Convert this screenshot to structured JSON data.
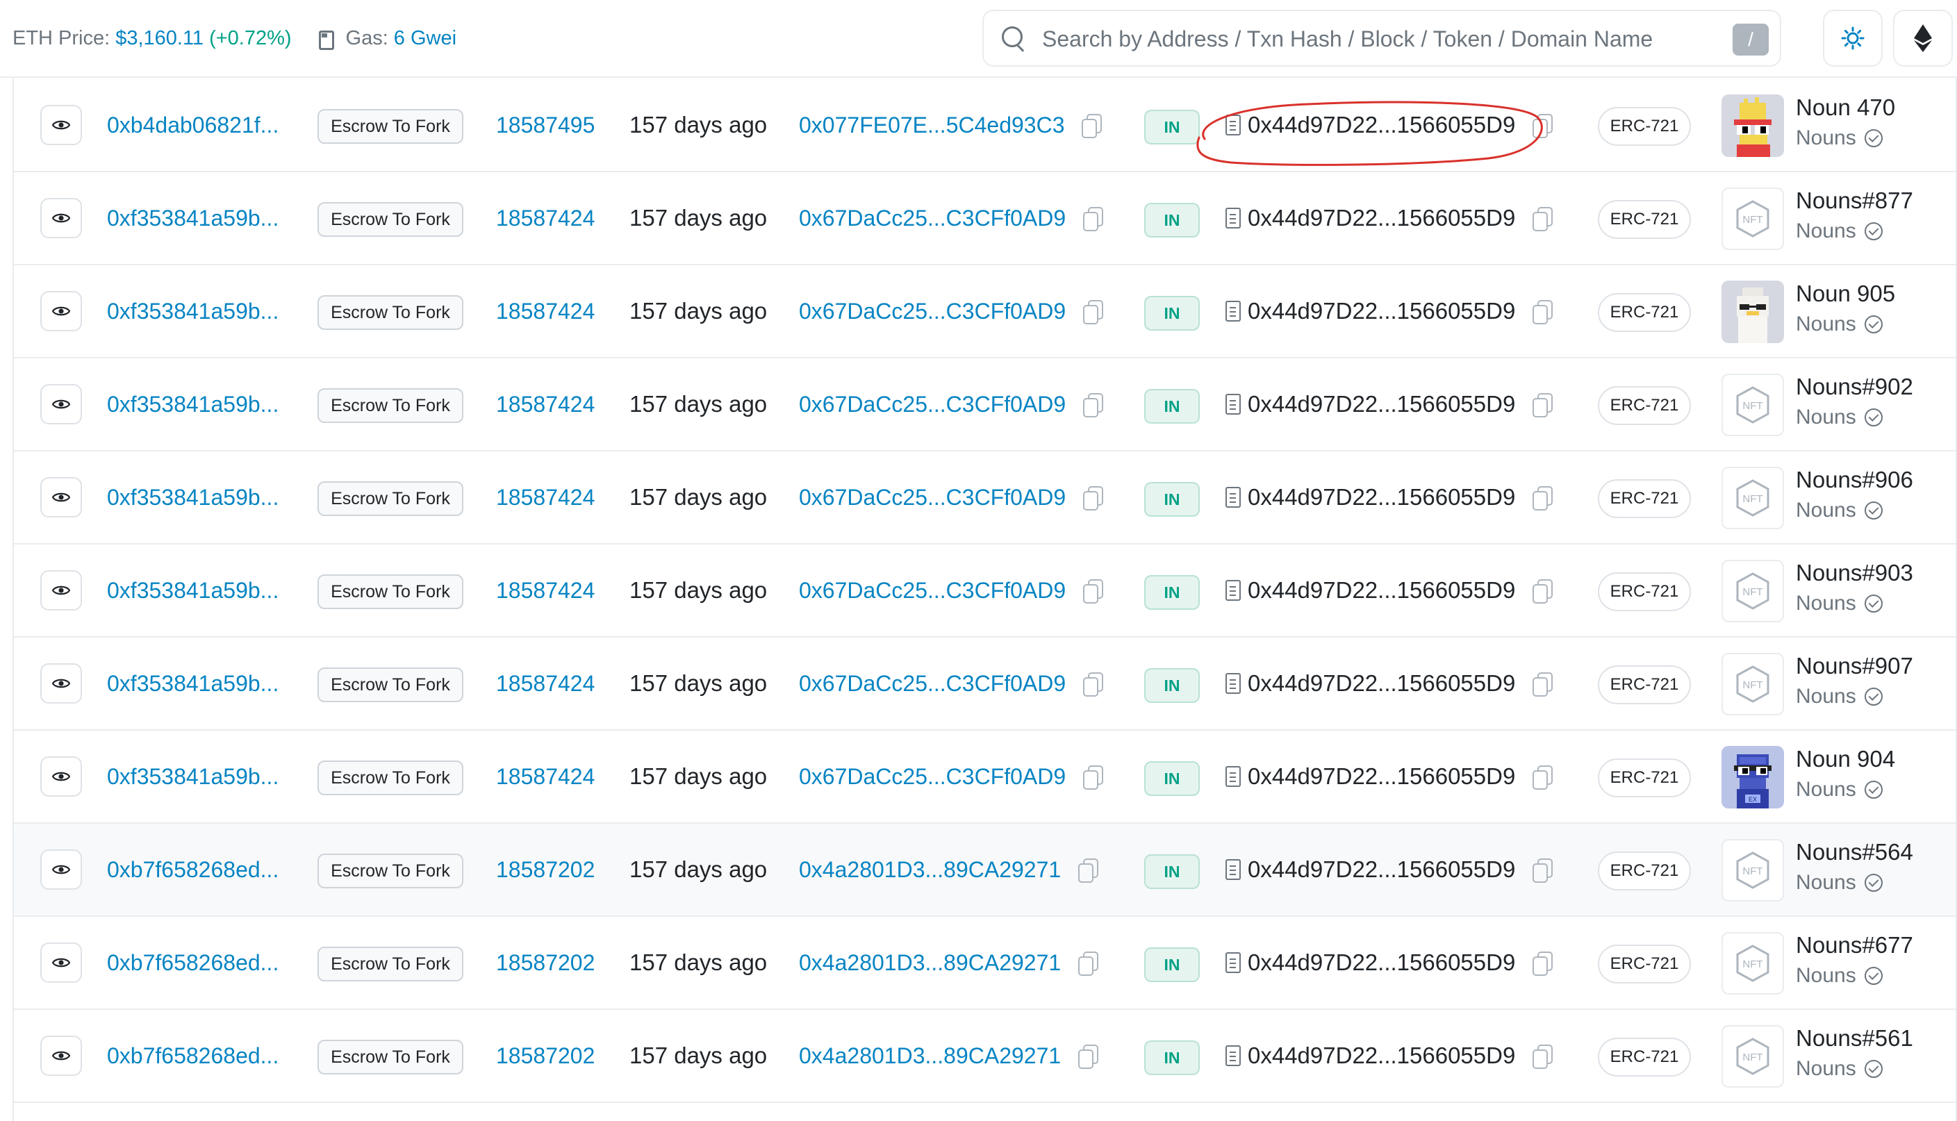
{
  "header": {
    "eth_price_label": "ETH Price:",
    "eth_price_value": "$3,160.11",
    "eth_price_change": "(+0.72%)",
    "gas_label": "Gas:",
    "gas_value": "6 Gwei",
    "search_placeholder": "Search by Address / Txn Hash / Block / Token / Domain Name",
    "search_shortcut": "/",
    "icons": [
      "search-icon",
      "sun-icon",
      "ethereum-icon"
    ]
  },
  "colors": {
    "link": "#0784c3",
    "in_badge": "#00a186",
    "annotation": "#d9312b",
    "muted": "#6c757d"
  },
  "rows": [
    {
      "tx_hash": "0xb4dab06821f...",
      "method": "Escrow To Fork",
      "block": "18587495",
      "age": "157 days ago",
      "from": "0x077FE07E...5C4ed93C3",
      "direction": "IN",
      "to": "0x44d97D22...1566055D9",
      "token_type": "ERC-721",
      "item_name": "Noun 470",
      "collection": "Nouns",
      "thumb": "noun-470"
    },
    {
      "tx_hash": "0xf353841a59b...",
      "method": "Escrow To Fork",
      "block": "18587424",
      "age": "157 days ago",
      "from": "0x67DaCc25...C3CFf0AD9",
      "direction": "IN",
      "to": "0x44d97D22...1566055D9",
      "token_type": "ERC-721",
      "item_name": "Nouns#877",
      "collection": "Nouns",
      "thumb": "nft-placeholder"
    },
    {
      "tx_hash": "0xf353841a59b...",
      "method": "Escrow To Fork",
      "block": "18587424",
      "age": "157 days ago",
      "from": "0x67DaCc25...C3CFf0AD9",
      "direction": "IN",
      "to": "0x44d97D22...1566055D9",
      "token_type": "ERC-721",
      "item_name": "Noun 905",
      "collection": "Nouns",
      "thumb": "noun-905"
    },
    {
      "tx_hash": "0xf353841a59b...",
      "method": "Escrow To Fork",
      "block": "18587424",
      "age": "157 days ago",
      "from": "0x67DaCc25...C3CFf0AD9",
      "direction": "IN",
      "to": "0x44d97D22...1566055D9",
      "token_type": "ERC-721",
      "item_name": "Nouns#902",
      "collection": "Nouns",
      "thumb": "nft-placeholder"
    },
    {
      "tx_hash": "0xf353841a59b...",
      "method": "Escrow To Fork",
      "block": "18587424",
      "age": "157 days ago",
      "from": "0x67DaCc25...C3CFf0AD9",
      "direction": "IN",
      "to": "0x44d97D22...1566055D9",
      "token_type": "ERC-721",
      "item_name": "Nouns#906",
      "collection": "Nouns",
      "thumb": "nft-placeholder"
    },
    {
      "tx_hash": "0xf353841a59b...",
      "method": "Escrow To Fork",
      "block": "18587424",
      "age": "157 days ago",
      "from": "0x67DaCc25...C3CFf0AD9",
      "direction": "IN",
      "to": "0x44d97D22...1566055D9",
      "token_type": "ERC-721",
      "item_name": "Nouns#903",
      "collection": "Nouns",
      "thumb": "nft-placeholder"
    },
    {
      "tx_hash": "0xf353841a59b...",
      "method": "Escrow To Fork",
      "block": "18587424",
      "age": "157 days ago",
      "from": "0x67DaCc25...C3CFf0AD9",
      "direction": "IN",
      "to": "0x44d97D22...1566055D9",
      "token_type": "ERC-721",
      "item_name": "Nouns#907",
      "collection": "Nouns",
      "thumb": "nft-placeholder"
    },
    {
      "tx_hash": "0xf353841a59b...",
      "method": "Escrow To Fork",
      "block": "18587424",
      "age": "157 days ago",
      "from": "0x67DaCc25...C3CFf0AD9",
      "direction": "IN",
      "to": "0x44d97D22...1566055D9",
      "token_type": "ERC-721",
      "item_name": "Noun 904",
      "collection": "Nouns",
      "thumb": "noun-904"
    },
    {
      "tx_hash": "0xb7f658268ed...",
      "method": "Escrow To Fork",
      "block": "18587202",
      "age": "157 days ago",
      "from": "0x4a2801D3...89CA29271",
      "direction": "IN",
      "to": "0x44d97D22...1566055D9",
      "token_type": "ERC-721",
      "item_name": "Nouns#564",
      "collection": "Nouns",
      "thumb": "nft-placeholder"
    },
    {
      "tx_hash": "0xb7f658268ed...",
      "method": "Escrow To Fork",
      "block": "18587202",
      "age": "157 days ago",
      "from": "0x4a2801D3...89CA29271",
      "direction": "IN",
      "to": "0x44d97D22...1566055D9",
      "token_type": "ERC-721",
      "item_name": "Nouns#677",
      "collection": "Nouns",
      "thumb": "nft-placeholder"
    },
    {
      "tx_hash": "0xb7f658268ed...",
      "method": "Escrow To Fork",
      "block": "18587202",
      "age": "157 days ago",
      "from": "0x4a2801D3...89CA29271",
      "direction": "IN",
      "to": "0x44d97D22...1566055D9",
      "token_type": "ERC-721",
      "item_name": "Nouns#561",
      "collection": "Nouns",
      "thumb": "nft-placeholder"
    }
  ]
}
